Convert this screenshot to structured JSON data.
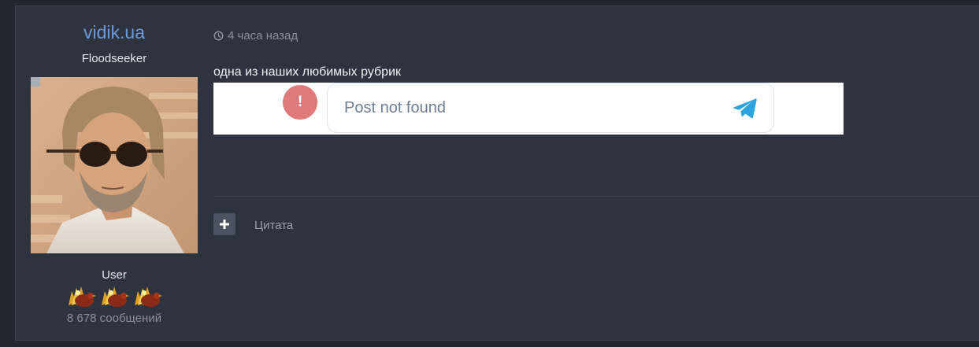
{
  "author": {
    "name": "vidik.ua",
    "title": "Floodseeker",
    "group": "User",
    "post_count": "8 678 сообщений",
    "rank_icons": [
      "turkey-icon",
      "turkey-icon",
      "turkey-icon"
    ]
  },
  "post": {
    "date": "4 часа назад",
    "date_icon": "clock-icon",
    "text": "одна из наших любимых рубрик"
  },
  "embed": {
    "message": "Post not found",
    "badge": "!",
    "icon": "telegram-icon"
  },
  "actions": {
    "quote_icon": "plus-icon",
    "quote_label": "Цитата"
  },
  "colors": {
    "author_link": "#6b9ad9",
    "background": "#2e3340",
    "error_badge": "#e07a7a",
    "telegram": "#2aa3e0"
  }
}
